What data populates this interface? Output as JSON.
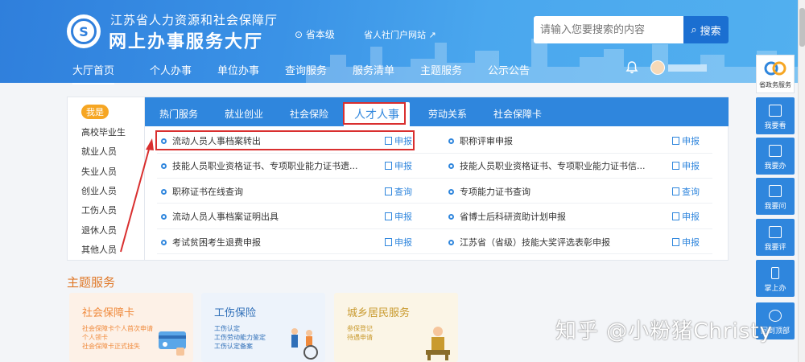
{
  "header": {
    "subtitle": "江苏省人力资源和社会保障厅",
    "title": "网上办事服务大厅",
    "region": "省本级",
    "portal_link": "省人社门户网站",
    "search_placeholder": "请输入您要搜索的内容",
    "search_button": "搜索"
  },
  "nav": [
    "大厅首页",
    "个人办事",
    "单位办事",
    "查询服务",
    "服务清单",
    "主题服务",
    "公示公告"
  ],
  "left_panel": {
    "badge": "我是",
    "persons": [
      "高校毕业生",
      "就业人员",
      "失业人员",
      "创业人员",
      "工伤人员",
      "退休人员",
      "其他人员"
    ]
  },
  "tabs": [
    "热门服务",
    "就业创业",
    "社会保险",
    "人才人事",
    "劳动关系",
    "社会保障卡"
  ],
  "active_tab": "人才人事",
  "services": [
    {
      "name": "流动人员人事档案转出",
      "action": "申报"
    },
    {
      "name": "职称评审申报",
      "action": "申报"
    },
    {
      "name": "技能人员职业资格证书、专项职业能力证书遗...",
      "action": "申报"
    },
    {
      "name": "技能人员职业资格证书、专项职业能力证书信...",
      "action": "申报"
    },
    {
      "name": "职称证书在线查询",
      "action": "查询"
    },
    {
      "name": "专项能力证书查询",
      "action": "查询"
    },
    {
      "name": "流动人员人事档案证明出具",
      "action": "申报"
    },
    {
      "name": "省博士后科研资助计划申报",
      "action": "申报"
    },
    {
      "name": "考试贫困考生退费申报",
      "action": "申报"
    },
    {
      "name": "江苏省（省级）技能大奖评选表彰申报",
      "action": "申报"
    }
  ],
  "topic": {
    "title": "主题服务",
    "cards": [
      {
        "title": "社会保障卡",
        "items": [
          "社会保障卡个人首次申请",
          "个人领卡",
          "社会保障卡正式挂失"
        ],
        "color": "#f08a3c",
        "bg": "#fdf1e7"
      },
      {
        "title": "工伤保险",
        "items": [
          "工伤认定",
          "工伤劳动能力鉴定",
          "工伤认定备案"
        ],
        "color": "#2f6fb8",
        "bg": "#edf3fb"
      },
      {
        "title": "城乡居民服务",
        "items": [
          "参保登记",
          "待遇申请"
        ],
        "color": "#c99a2e",
        "bg": "#fbf5e6"
      }
    ]
  },
  "sidebar": {
    "top": "省政务服务",
    "buttons": [
      "我要看",
      "我要办",
      "我要问",
      "我要评",
      "掌上办"
    ],
    "last": "回到顶部"
  },
  "watermark": "知乎 @小粉猪Christy",
  "colors": {
    "primary": "#2f86dd",
    "highlight": "#d92f2f",
    "accent": "#e07a2b"
  }
}
